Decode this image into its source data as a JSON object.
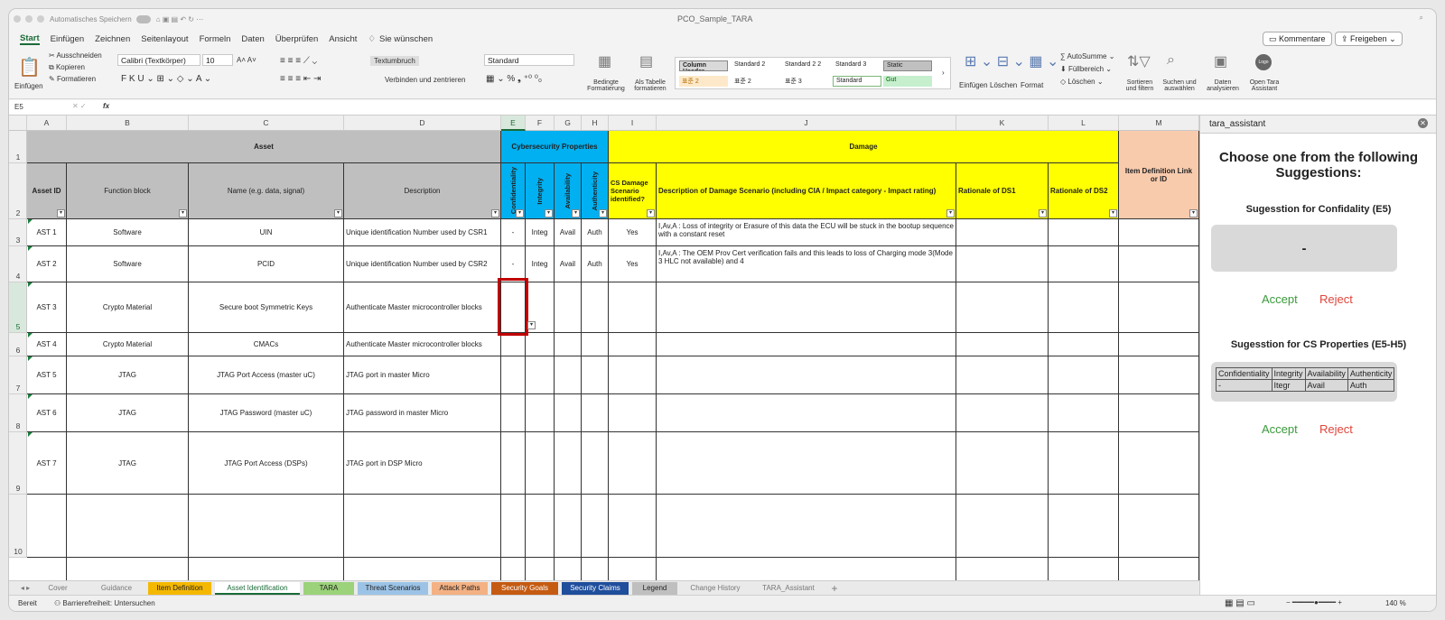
{
  "titlebar": {
    "autosave": "Automatisches Speichern",
    "doc_title": "PCO_Sample_TARA"
  },
  "menu": [
    "Start",
    "Einfügen",
    "Zeichnen",
    "Seitenlayout",
    "Formeln",
    "Daten",
    "Überprüfen",
    "Ansicht"
  ],
  "tell_me": "Sie wünschen",
  "top_buttons": {
    "comments": "Kommentare",
    "share": "Freigeben"
  },
  "ribbon": {
    "paste": "Einfügen",
    "cut": "Ausschneiden",
    "copy": "Kopieren",
    "format": "Formatieren",
    "font": "Calibri (Textkörper)",
    "font_size": "10",
    "wrap": "Textumbruch",
    "merge": "Verbinden und zentrieren",
    "number_format": "Standard",
    "cond_format": "Bedingte Formatierung",
    "as_table": "Als Tabelle formatieren",
    "styles": [
      "Column Header",
      "Standard 2",
      "Standard 2 2",
      "Standard 3",
      "Static",
      "표준 2",
      "표준 2",
      "표준 3",
      "Standard",
      "Gut"
    ],
    "insert": "Einfügen",
    "delete": "Löschen",
    "format2": "Format",
    "autosum": "AutoSumme",
    "fill": "Füllbereich",
    "clear": "Löschen",
    "sort": "Sortieren und filtern",
    "find": "Suchen und auswählen",
    "analyze": "Daten analysieren",
    "open_tara": "Open Tara Assistant",
    "logo": "Logo"
  },
  "formula_bar": {
    "cell_ref": "E5",
    "fx": "fx",
    "value": ""
  },
  "columns": [
    "A",
    "B",
    "C",
    "D",
    "E",
    "F",
    "G",
    "H",
    "I",
    "J",
    "K",
    "L",
    "M"
  ],
  "rows": [
    "1",
    "2",
    "3",
    "4",
    "5",
    "6",
    "7",
    "8",
    "9",
    "10"
  ],
  "headers": {
    "asset": "Asset",
    "cyber": "Cybersecurity Properties",
    "damage": "Damage",
    "asset_id": "Asset ID",
    "function_block": "Function block",
    "name": "Name (e.g. data, signal)",
    "description": "Description",
    "confidentiality": "Confidentiality",
    "integrity": "Integrity",
    "availability": "Availability",
    "authenticity": "Authenticity",
    "cs_damage": "CS Damage Scenario identified?",
    "damage_desc": "Description of Damage Scenario (including CIA / Impact category - Impact rating)",
    "rat1": "Rationale of DS1",
    "rat2": "Rationale of DS2",
    "item_def": "Item Definition Link or ID"
  },
  "data_rows": [
    {
      "id": "AST 1",
      "fb": "Software",
      "name": "UIN",
      "desc": "Unique identification Number used by CSR1",
      "c": "-",
      "i": "Integ",
      "a": "Avail",
      "au": "Auth",
      "cs": "Yes",
      "dmg": "I,Av,A : Loss of integrity or Erasure of this data the ECU will be stuck in the bootup sequence  with a constant reset"
    },
    {
      "id": "AST 2",
      "fb": "Software",
      "name": "PCID",
      "desc": "Unique identification Number used by CSR2",
      "c": "-",
      "i": "Integ",
      "a": "Avail",
      "au": "Auth",
      "cs": "Yes",
      "dmg": "I,Av,A : The OEM Prov Cert verification fails and this leads to loss of Charging mode 3(Mode 3 HLC not available) and 4"
    },
    {
      "id": "AST 3",
      "fb": "Crypto Material",
      "name": "Secure boot Symmetric Keys",
      "desc": "Authenticate Master microcontroller blocks",
      "c": "",
      "i": "",
      "a": "",
      "au": "",
      "cs": "",
      "dmg": ""
    },
    {
      "id": "AST 4",
      "fb": "Crypto Material",
      "name": "CMACs",
      "desc": "Authenticate Master microcontroller blocks",
      "c": "",
      "i": "",
      "a": "",
      "au": "",
      "cs": "",
      "dmg": ""
    },
    {
      "id": "AST 5",
      "fb": "JTAG",
      "name": "JTAG Port Access (master uC)",
      "desc": "JTAG port in master Micro",
      "c": "",
      "i": "",
      "a": "",
      "au": "",
      "cs": "",
      "dmg": ""
    },
    {
      "id": "AST 6",
      "fb": "JTAG",
      "name": "JTAG Password (master uC)",
      "desc": "JTAG password in master Micro",
      "c": "",
      "i": "",
      "a": "",
      "au": "",
      "cs": "",
      "dmg": ""
    },
    {
      "id": "AST 7",
      "fb": "JTAG",
      "name": "JTAG Port Access (DSPs)",
      "desc": "JTAG port in DSP Micro",
      "c": "",
      "i": "",
      "a": "",
      "au": "",
      "cs": "",
      "dmg": ""
    }
  ],
  "sheet_tabs": [
    {
      "label": "Cover",
      "color": "#eaeaea",
      "text": "#777"
    },
    {
      "label": "Guidance",
      "color": "#eaeaea",
      "text": "#777"
    },
    {
      "label": "Item Definition",
      "color": "#f5b800",
      "text": "#222"
    },
    {
      "label": "Asset Identification",
      "color": "#ffffff",
      "text": "#1a6b37"
    },
    {
      "label": "TARA",
      "color": "#9bd27a",
      "text": "#222"
    },
    {
      "label": "Threat Scenarios",
      "color": "#9cc3e6",
      "text": "#222"
    },
    {
      "label": "Attack Paths",
      "color": "#f4b183",
      "text": "#222"
    },
    {
      "label": "Security Goals",
      "color": "#c55a11",
      "text": "#fff"
    },
    {
      "label": "Security Claims",
      "color": "#1f4e9c",
      "text": "#fff"
    },
    {
      "label": "Legend",
      "color": "#bfbfbf",
      "text": "#222"
    },
    {
      "label": "Change History",
      "color": "#eaeaea",
      "text": "#777"
    },
    {
      "label": "TARA_Assistant",
      "color": "#eaeaea",
      "text": "#777"
    }
  ],
  "status": {
    "ready": "Bereit",
    "accessibility": "Barrierefreiheit: Untersuchen",
    "zoom": "140 %"
  },
  "pane": {
    "title": "tara_assistant",
    "heading": "Choose one from the following Suggestions:",
    "sug1_title": "Sugesstion for Confidality (E5)",
    "sug1_value": "-",
    "accept": "Accept",
    "reject": "Reject",
    "sug2_title": "Sugesstion for CS Properties (E5-H5)",
    "table_headers": [
      "Confidentiality",
      "Integrity",
      "Availability",
      "Authenticity"
    ],
    "table_values": [
      "-",
      "Itegr",
      "Avail",
      "Auth"
    ]
  },
  "colors": {
    "gray_header": "#bfbfbf",
    "cyan_header": "#00b0f0",
    "yellow_header": "#ffff00",
    "salmon_header": "#f8cbad",
    "selection": "#c00000"
  }
}
